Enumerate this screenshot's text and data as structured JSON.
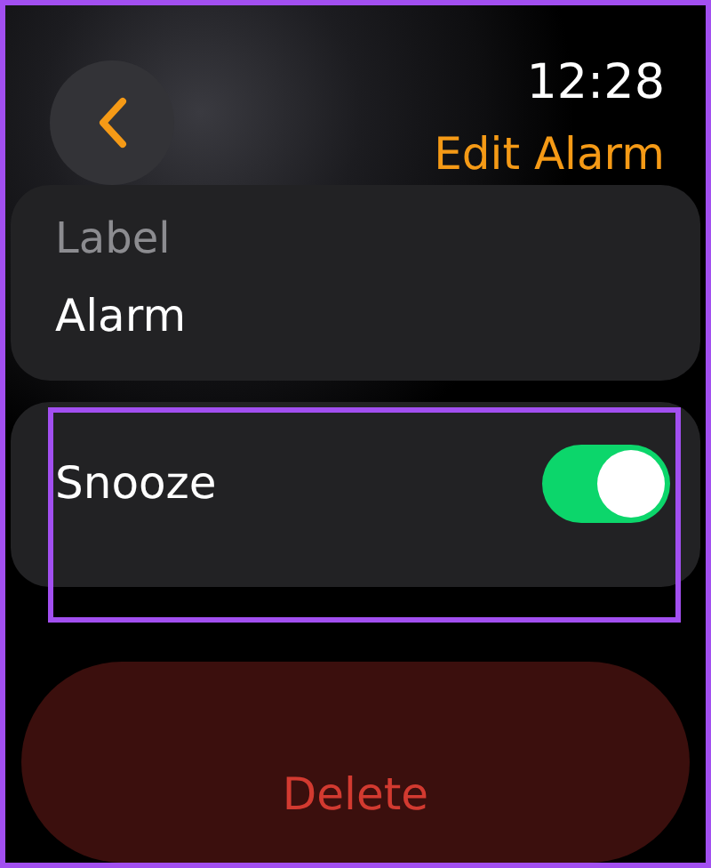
{
  "status_bar": {
    "time": "12:28"
  },
  "header": {
    "title": "Edit Alarm"
  },
  "label_field": {
    "caption": "Label",
    "value": "Alarm"
  },
  "snooze": {
    "label": "Snooze",
    "on": true,
    "highlighted": true
  },
  "buttons": [
    {
      "label": "Delete",
      "kind": "destructive"
    }
  ]
}
